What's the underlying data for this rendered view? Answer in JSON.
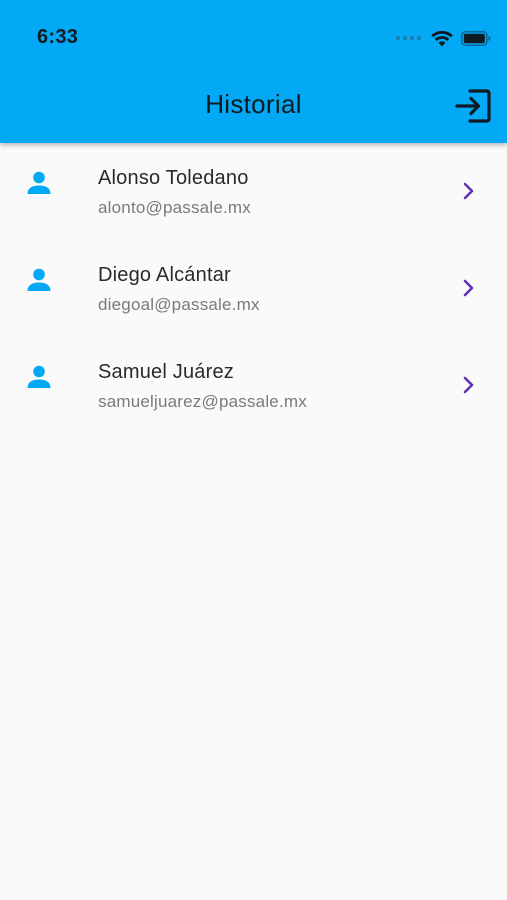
{
  "status_bar": {
    "time": "6:33"
  },
  "header": {
    "title": "Historial",
    "action_icon": "logout-icon"
  },
  "colors": {
    "appbar": "#03a9f4",
    "avatar": "#03a9f4",
    "chevron": "#5e35b1",
    "background": "#fafafa"
  },
  "users": [
    {
      "name": "Alonso Toledano",
      "email": "alonto@passale.mx",
      "icon": "person-icon"
    },
    {
      "name": "Diego Alcántar",
      "email": "diegoal@passale.mx",
      "icon": "person-icon"
    },
    {
      "name": "Samuel Juárez",
      "email": "samueljuarez@passale.mx",
      "icon": "person-icon"
    }
  ]
}
